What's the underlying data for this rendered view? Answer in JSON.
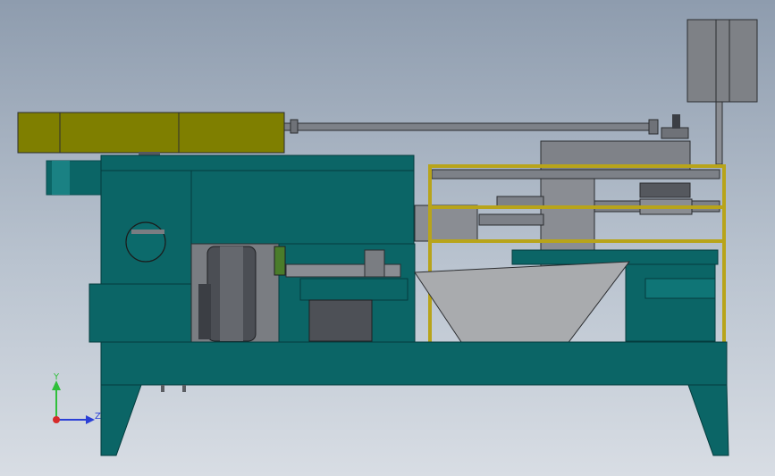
{
  "viewport": {
    "axis_triad": {
      "y_label": "Y",
      "z_label": "Z",
      "y_color": "#2fbf3a",
      "z_color": "#2a3fd6",
      "origin_color": "#d62a2a"
    }
  },
  "colors": {
    "frame_teal": "#0b6566",
    "frame_teal_dark": "#074c4d",
    "motor_olive": "#7f7f00",
    "yellow_frame": "#b8a41a",
    "steel_grey": "#8a8d93",
    "dark_steel": "#55585e",
    "hopper_grey": "#a9abae"
  }
}
